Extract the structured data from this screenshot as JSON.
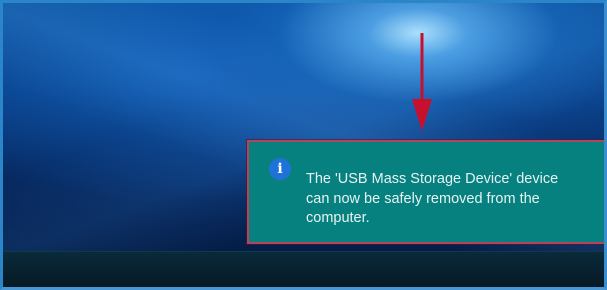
{
  "notification": {
    "icon": "info-icon",
    "message": "The 'USB Mass Storage Device' device can now be safely removed from the computer."
  },
  "colors": {
    "toast_background": "#07817f",
    "toast_border": "#b0455e",
    "arrow": "#c8102e",
    "info_icon": "#1f73d8"
  }
}
